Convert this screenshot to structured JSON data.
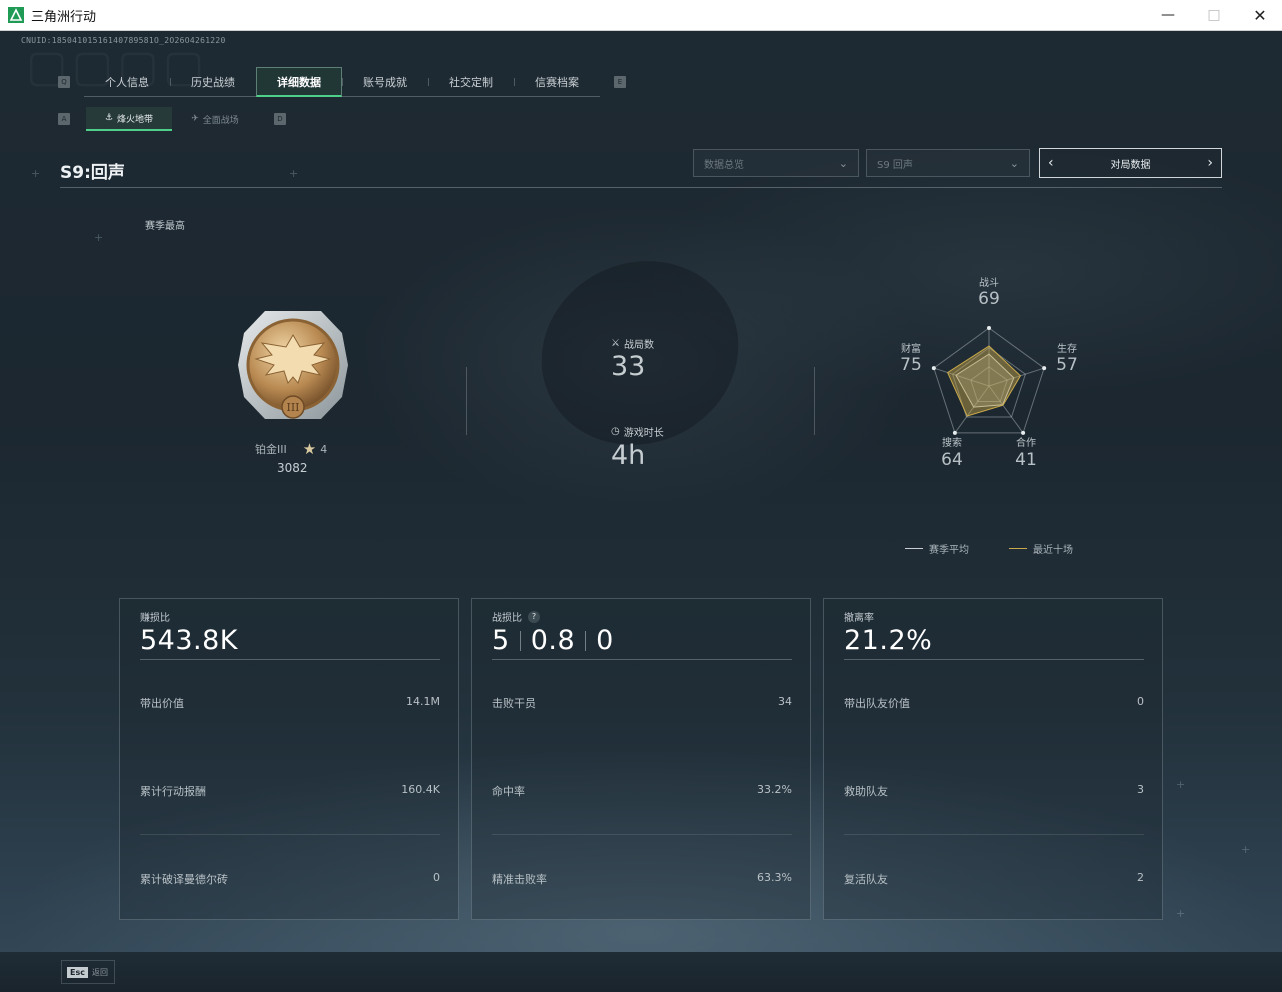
{
  "window": {
    "title": "三角洲行动"
  },
  "header": {
    "uid": "CNUID:18504101516140789581O_2O26O4261220",
    "nav_key_left": "Q",
    "nav_key_right": "E",
    "tabs": [
      {
        "label": "个人信息"
      },
      {
        "label": "历史战绩"
      },
      {
        "label": "详细数据",
        "active": true
      },
      {
        "label": "账号成就"
      },
      {
        "label": "社交定制"
      },
      {
        "label": "信赛档案"
      }
    ],
    "sub_key_left": "A",
    "sub_key_right": "D",
    "sub_tabs": [
      {
        "label": "烽火地带",
        "active": true
      },
      {
        "label": "全面战场"
      }
    ]
  },
  "season": {
    "title": "S9:回声",
    "filter_data": "数据总览",
    "filter_season": "S9 回声",
    "match_data_label": "对局数据",
    "best_label": "赛季最高"
  },
  "rank": {
    "name": "铂金III",
    "stars": "4",
    "score": "3082",
    "medal_numeral": "III"
  },
  "summary": {
    "matches_label": "战局数",
    "matches_value": "33",
    "playtime_label": "游戏时长",
    "playtime_value": "4h"
  },
  "radar": {
    "axes": [
      {
        "label": "战斗",
        "value": "69"
      },
      {
        "label": "生存",
        "value": "57"
      },
      {
        "label": "合作",
        "value": "41"
      },
      {
        "label": "搜索",
        "value": "64"
      },
      {
        "label": "财富",
        "value": "75"
      }
    ],
    "legend": [
      {
        "label": "赛季平均",
        "color": "#c8ced1"
      },
      {
        "label": "最近十场",
        "color": "#c9a94a"
      }
    ],
    "season_avg": [
      0.55,
      0.45,
      0.4,
      0.45,
      0.6
    ],
    "recent_ten": [
      0.69,
      0.57,
      0.41,
      0.64,
      0.75
    ]
  },
  "cards": [
    {
      "label": "赚损比",
      "value": "543.8K",
      "rows": [
        {
          "label": "带出价值",
          "value": "14.1M"
        },
        {
          "label": "累计行动报酬",
          "value": "160.4K"
        },
        {
          "label": "累计破译曼德尔砖",
          "value": "0"
        }
      ]
    },
    {
      "label": "战损比",
      "kd": [
        "5",
        "0.8",
        "0"
      ],
      "rows": [
        {
          "label": "击败干员",
          "value": "34"
        },
        {
          "label": "命中率",
          "value": "33.2%"
        },
        {
          "label": "精准击败率",
          "value": "63.3%"
        }
      ]
    },
    {
      "label": "撤离率",
      "value": "21.2%",
      "rows": [
        {
          "label": "带出队友价值",
          "value": "0"
        },
        {
          "label": "救助队友",
          "value": "3"
        },
        {
          "label": "复活队友",
          "value": "2"
        }
      ]
    }
  ],
  "footer": {
    "esc_key": "Esc",
    "esc_label": "返回"
  },
  "colors": {
    "accent": "#4fd08a",
    "gold": "#c9a94a"
  }
}
